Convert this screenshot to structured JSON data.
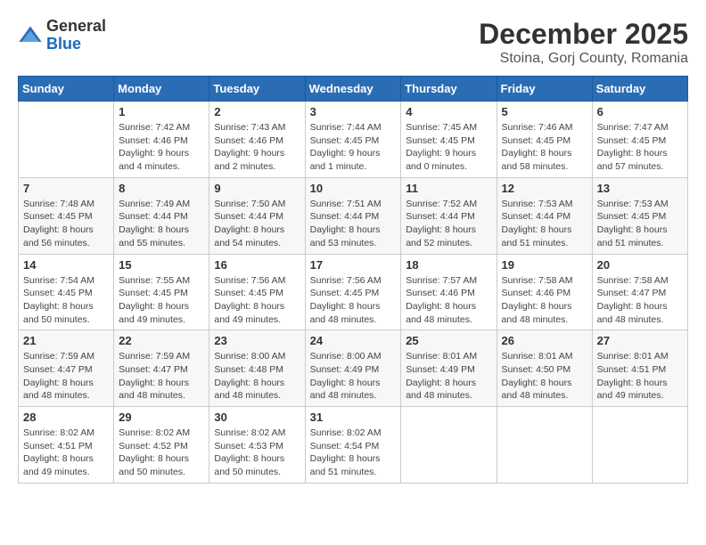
{
  "header": {
    "logo_general": "General",
    "logo_blue": "Blue",
    "month_title": "December 2025",
    "subtitle": "Stoina, Gorj County, Romania"
  },
  "weekdays": [
    "Sunday",
    "Monday",
    "Tuesday",
    "Wednesday",
    "Thursday",
    "Friday",
    "Saturday"
  ],
  "weeks": [
    [
      {
        "day": "",
        "info": ""
      },
      {
        "day": "1",
        "info": "Sunrise: 7:42 AM\nSunset: 4:46 PM\nDaylight: 9 hours\nand 4 minutes."
      },
      {
        "day": "2",
        "info": "Sunrise: 7:43 AM\nSunset: 4:46 PM\nDaylight: 9 hours\nand 2 minutes."
      },
      {
        "day": "3",
        "info": "Sunrise: 7:44 AM\nSunset: 4:45 PM\nDaylight: 9 hours\nand 1 minute."
      },
      {
        "day": "4",
        "info": "Sunrise: 7:45 AM\nSunset: 4:45 PM\nDaylight: 9 hours\nand 0 minutes."
      },
      {
        "day": "5",
        "info": "Sunrise: 7:46 AM\nSunset: 4:45 PM\nDaylight: 8 hours\nand 58 minutes."
      },
      {
        "day": "6",
        "info": "Sunrise: 7:47 AM\nSunset: 4:45 PM\nDaylight: 8 hours\nand 57 minutes."
      }
    ],
    [
      {
        "day": "7",
        "info": "Sunrise: 7:48 AM\nSunset: 4:45 PM\nDaylight: 8 hours\nand 56 minutes."
      },
      {
        "day": "8",
        "info": "Sunrise: 7:49 AM\nSunset: 4:44 PM\nDaylight: 8 hours\nand 55 minutes."
      },
      {
        "day": "9",
        "info": "Sunrise: 7:50 AM\nSunset: 4:44 PM\nDaylight: 8 hours\nand 54 minutes."
      },
      {
        "day": "10",
        "info": "Sunrise: 7:51 AM\nSunset: 4:44 PM\nDaylight: 8 hours\nand 53 minutes."
      },
      {
        "day": "11",
        "info": "Sunrise: 7:52 AM\nSunset: 4:44 PM\nDaylight: 8 hours\nand 52 minutes."
      },
      {
        "day": "12",
        "info": "Sunrise: 7:53 AM\nSunset: 4:44 PM\nDaylight: 8 hours\nand 51 minutes."
      },
      {
        "day": "13",
        "info": "Sunrise: 7:53 AM\nSunset: 4:45 PM\nDaylight: 8 hours\nand 51 minutes."
      }
    ],
    [
      {
        "day": "14",
        "info": "Sunrise: 7:54 AM\nSunset: 4:45 PM\nDaylight: 8 hours\nand 50 minutes."
      },
      {
        "day": "15",
        "info": "Sunrise: 7:55 AM\nSunset: 4:45 PM\nDaylight: 8 hours\nand 49 minutes."
      },
      {
        "day": "16",
        "info": "Sunrise: 7:56 AM\nSunset: 4:45 PM\nDaylight: 8 hours\nand 49 minutes."
      },
      {
        "day": "17",
        "info": "Sunrise: 7:56 AM\nSunset: 4:45 PM\nDaylight: 8 hours\nand 48 minutes."
      },
      {
        "day": "18",
        "info": "Sunrise: 7:57 AM\nSunset: 4:46 PM\nDaylight: 8 hours\nand 48 minutes."
      },
      {
        "day": "19",
        "info": "Sunrise: 7:58 AM\nSunset: 4:46 PM\nDaylight: 8 hours\nand 48 minutes."
      },
      {
        "day": "20",
        "info": "Sunrise: 7:58 AM\nSunset: 4:47 PM\nDaylight: 8 hours\nand 48 minutes."
      }
    ],
    [
      {
        "day": "21",
        "info": "Sunrise: 7:59 AM\nSunset: 4:47 PM\nDaylight: 8 hours\nand 48 minutes."
      },
      {
        "day": "22",
        "info": "Sunrise: 7:59 AM\nSunset: 4:47 PM\nDaylight: 8 hours\nand 48 minutes."
      },
      {
        "day": "23",
        "info": "Sunrise: 8:00 AM\nSunset: 4:48 PM\nDaylight: 8 hours\nand 48 minutes."
      },
      {
        "day": "24",
        "info": "Sunrise: 8:00 AM\nSunset: 4:49 PM\nDaylight: 8 hours\nand 48 minutes."
      },
      {
        "day": "25",
        "info": "Sunrise: 8:01 AM\nSunset: 4:49 PM\nDaylight: 8 hours\nand 48 minutes."
      },
      {
        "day": "26",
        "info": "Sunrise: 8:01 AM\nSunset: 4:50 PM\nDaylight: 8 hours\nand 48 minutes."
      },
      {
        "day": "27",
        "info": "Sunrise: 8:01 AM\nSunset: 4:51 PM\nDaylight: 8 hours\nand 49 minutes."
      }
    ],
    [
      {
        "day": "28",
        "info": "Sunrise: 8:02 AM\nSunset: 4:51 PM\nDaylight: 8 hours\nand 49 minutes."
      },
      {
        "day": "29",
        "info": "Sunrise: 8:02 AM\nSunset: 4:52 PM\nDaylight: 8 hours\nand 50 minutes."
      },
      {
        "day": "30",
        "info": "Sunrise: 8:02 AM\nSunset: 4:53 PM\nDaylight: 8 hours\nand 50 minutes."
      },
      {
        "day": "31",
        "info": "Sunrise: 8:02 AM\nSunset: 4:54 PM\nDaylight: 8 hours\nand 51 minutes."
      },
      {
        "day": "",
        "info": ""
      },
      {
        "day": "",
        "info": ""
      },
      {
        "day": "",
        "info": ""
      }
    ]
  ]
}
